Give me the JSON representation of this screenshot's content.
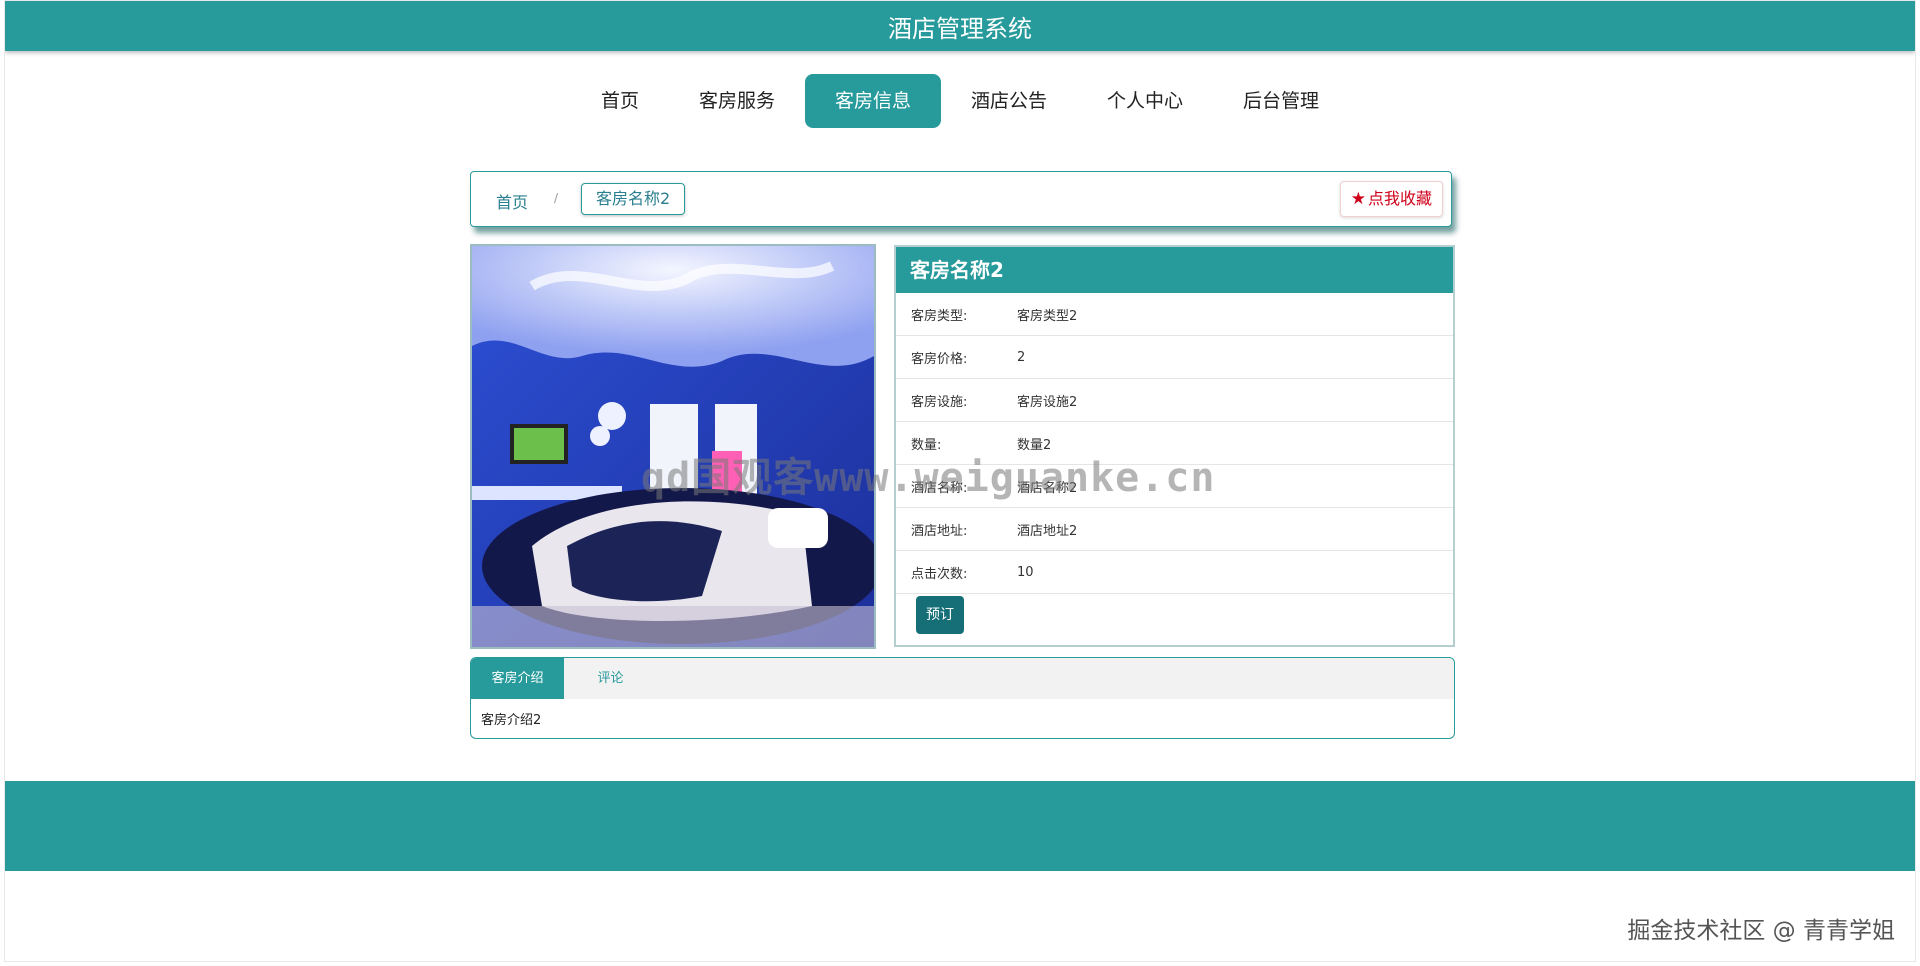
{
  "app": {
    "title": "酒店管理系统"
  },
  "nav": {
    "items": [
      {
        "label": "首页"
      },
      {
        "label": "客房服务"
      },
      {
        "label": "客房信息",
        "active": true
      },
      {
        "label": "酒店公告"
      },
      {
        "label": "个人中心"
      },
      {
        "label": "后台管理"
      }
    ]
  },
  "breadcrumb": {
    "home": "首页",
    "separator": "/",
    "current": "客房名称2"
  },
  "favorite": {
    "label": "点我收藏",
    "icon": "star-icon"
  },
  "room": {
    "name": "客房名称2",
    "fields": [
      {
        "key": "客房类型:",
        "value": "客房类型2"
      },
      {
        "key": "客房价格:",
        "value": "2"
      },
      {
        "key": "客房设施:",
        "value": "客房设施2"
      },
      {
        "key": "数量:",
        "value": "数量2"
      },
      {
        "key": "酒店名称:",
        "value": "酒店名称2"
      },
      {
        "key": "酒店地址:",
        "value": "酒店地址2"
      },
      {
        "key": "点击次数:",
        "value": "10"
      }
    ],
    "book_label": "预订"
  },
  "tabs": {
    "items": [
      {
        "label": "客房介绍",
        "active": true
      },
      {
        "label": "评论"
      }
    ],
    "content": "客房介绍2"
  },
  "watermarks": {
    "center": "qd国观客www.weiguanke.cn",
    "bottom": "掘金技术社区 @ 青青学姐"
  },
  "colors": {
    "primary": "#279a9b",
    "favorite": "#d0021b",
    "book": "#166f77"
  }
}
